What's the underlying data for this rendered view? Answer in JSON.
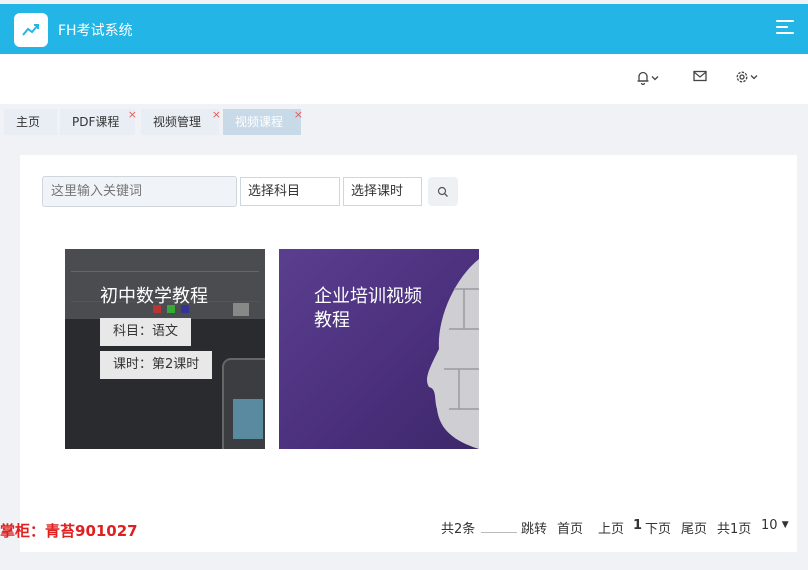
{
  "app": {
    "title": "FH考试系统",
    "logo_icon": "trend-chart-icon"
  },
  "colors": {
    "topbar": "#22b5e6",
    "watermark": "#e02020",
    "tab_close": "#e65a5a"
  },
  "header": {
    "icons": [
      "bell-icon",
      "mail-icon",
      "gear-icon"
    ]
  },
  "tabs": [
    {
      "label": "主页"
    },
    {
      "label": "PDF课程"
    },
    {
      "label": "视频管理"
    },
    {
      "label": "视频课程"
    }
  ],
  "tab_close_glyph": "×",
  "search": {
    "placeholder": "这里输入关键词",
    "subject_select": "选择科目",
    "hours_select": "选择课时"
  },
  "cards": [
    {
      "title": "初中数学教程",
      "subject": "科目：语文",
      "hours": "课时：第2课时"
    },
    {
      "title_line1": "企业培训视频",
      "title_line2": "教程"
    }
  ],
  "watermark": "掌柜：青苔901027",
  "pagination": {
    "total": "共2条",
    "jump": "跳转",
    "first": "首页",
    "prev": "上页",
    "current": "1",
    "next": "下页",
    "last": "尾页",
    "pages": "共1页",
    "page_size": "10"
  }
}
